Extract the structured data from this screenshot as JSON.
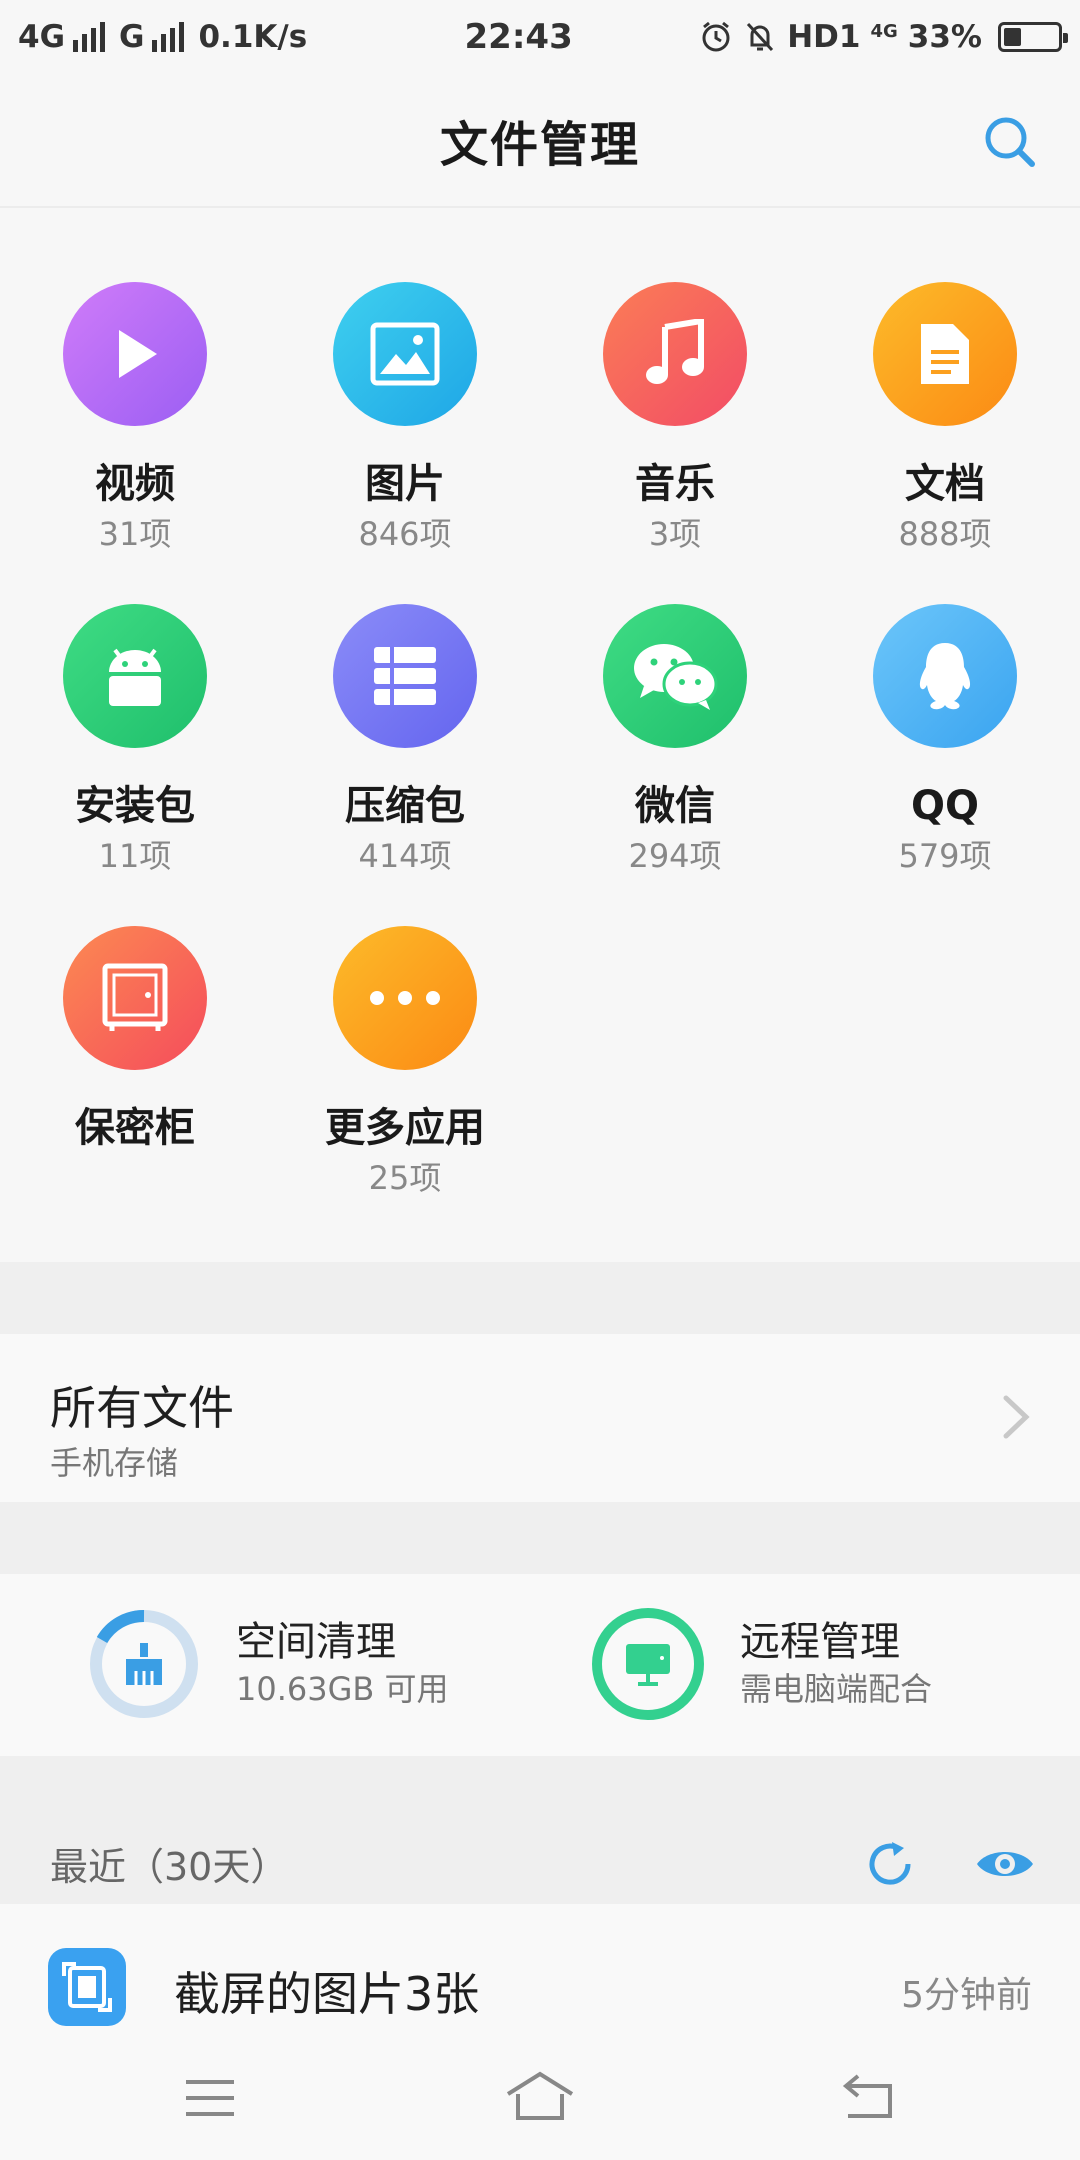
{
  "status_bar": {
    "network1": "4G",
    "network2": "G",
    "speed": "0.1K/s",
    "time": "22:43",
    "hd": "HD1",
    "network3": "4G",
    "battery_pct": "33%",
    "battery_level": 0.33
  },
  "header": {
    "title": "文件管理"
  },
  "categories": [
    {
      "label": "视频",
      "count": "31项"
    },
    {
      "label": "图片",
      "count": "846项"
    },
    {
      "label": "音乐",
      "count": "3项"
    },
    {
      "label": "文档",
      "count": "888项"
    },
    {
      "label": "安装包",
      "count": "11项"
    },
    {
      "label": "压缩包",
      "count": "414项"
    },
    {
      "label": "微信",
      "count": "294项"
    },
    {
      "label": "QQ",
      "count": "579项"
    },
    {
      "label": "保密柜",
      "count": ""
    },
    {
      "label": "更多应用",
      "count": "25项"
    }
  ],
  "all_files": {
    "title": "所有文件",
    "subtitle": "手机存储"
  },
  "tools": {
    "clean": {
      "title": "空间清理",
      "subtitle": "10.63GB 可用"
    },
    "remote": {
      "title": "远程管理",
      "subtitle": "需电脑端配合"
    }
  },
  "recent": {
    "title": "最近（30天）",
    "items": [
      {
        "title": "截屏的图片3张",
        "time": "5分钟前"
      }
    ]
  },
  "colors": {
    "accent": "#3a9ee4",
    "video": "#b86ef5",
    "image": "#2cc2e8",
    "music": "#f5635c",
    "docs": "#fca01f",
    "apk": "#2ed27a",
    "zip": "#7a7bf5",
    "wechat": "#33d079",
    "qq": "#55b8f7",
    "safe": "#f86a55",
    "more": "#fba51a"
  },
  "icons": {
    "search": "search-icon",
    "video": "play-icon",
    "image": "image-icon",
    "music": "music-note-icon",
    "docs": "document-icon",
    "apk": "android-icon",
    "zip": "archive-icon",
    "wechat": "wechat-icon",
    "qq": "qq-penguin-icon",
    "safe": "safe-icon",
    "more": "more-dots-icon",
    "clean": "broom-icon",
    "remote": "monitor-icon",
    "refresh": "refresh-icon",
    "eye": "eye-icon",
    "menu": "menu-icon",
    "home": "home-icon",
    "back": "back-icon"
  }
}
